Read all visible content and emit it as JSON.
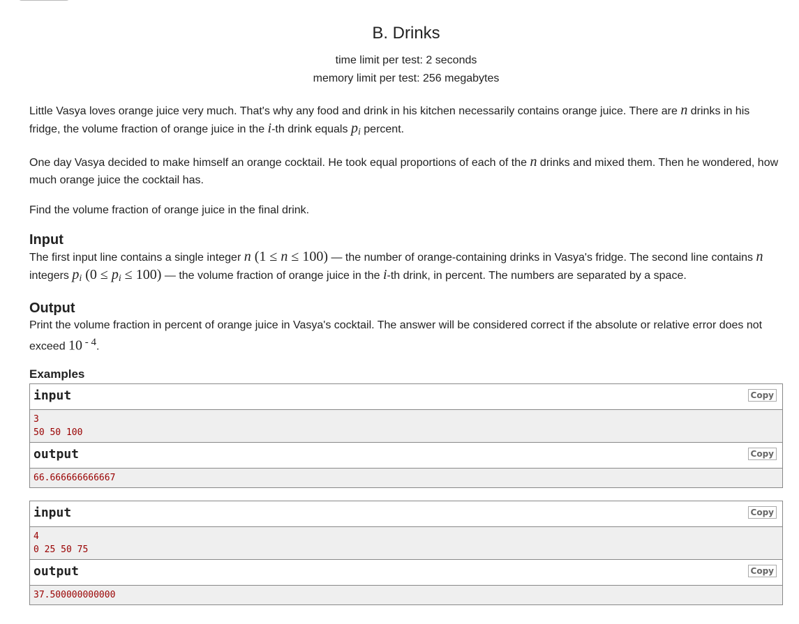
{
  "problem": {
    "title": "B. Drinks",
    "time_limit": "time limit per test: 2 seconds",
    "memory_limit": "memory limit per test: 256 megabytes"
  },
  "statement": {
    "p1": [
      "Little Vasya loves orange juice very much. That's why any food and drink in his kitchen necessarily contains orange juice. There are ",
      "n",
      " drinks in his fridge, the volume fraction of orange juice in the ",
      "i",
      "-th drink equals ",
      "p",
      "i",
      " percent."
    ],
    "p2": [
      "One day Vasya decided to make himself an orange cocktail. He took equal proportions of each of the ",
      "n",
      " drinks and mixed them. Then he wondered, how much orange juice the cocktail has."
    ],
    "p3": "Find the volume fraction of orange juice in the final drink."
  },
  "input_section": {
    "title": "Input",
    "parts": [
      "The first input line contains a single integer ",
      "n",
      " (1 ≤ ",
      "n",
      " ≤ 100)",
      " — the number of orange-containing drinks in Vasya's fridge. The second line contains ",
      "n",
      " integers ",
      "p",
      "i",
      " (0 ≤ ",
      "p",
      "i",
      " ≤ 100)",
      " — the volume fraction of orange juice in the ",
      "i",
      "-th drink, in percent. The numbers are separated by a space."
    ]
  },
  "output_section": {
    "title": "Output",
    "parts": [
      "Print the volume fraction in percent of orange juice in Vasya's cocktail. The answer will be considered correct if the absolute or relative error does not exceed ",
      "10",
      " - 4",
      "."
    ]
  },
  "examples": {
    "title": "Examples",
    "copy_label": "Copy",
    "input_label": "input",
    "output_label": "output",
    "items": [
      {
        "input": "3\n50 50 100",
        "output": "66.666666666667"
      },
      {
        "input": "4\n0 25 50 75",
        "output": "37.500000000000"
      }
    ]
  }
}
